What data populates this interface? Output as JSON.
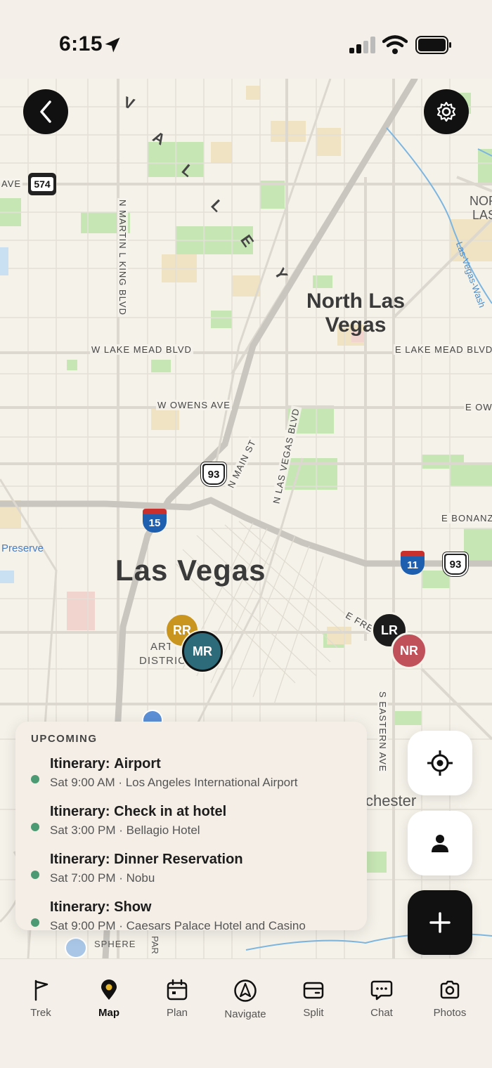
{
  "status_bar": {
    "time": "6:15"
  },
  "map": {
    "labels": {
      "city_main": "Las Vegas",
      "city_north_line1": "North Las",
      "city_north_line2": "Vegas",
      "valley": [
        "V",
        "A",
        "L",
        "L",
        "E",
        "Y"
      ],
      "streets": {
        "w_lake_mead": "W LAKE MEAD BLVD",
        "e_lake_mead": "E LAKE MEAD BLVD",
        "w_owens": "W OWENS AVE",
        "e_ow": "E OW",
        "n_martin": "N MARTIN L KING BLVD",
        "n_main": "N MAIN ST",
        "n_las_vegas_blvd": "N LAS VEGAS BLVD",
        "e_bonanza": "E BONANZ",
        "e_fremont": "E FRE",
        "s_eastern": "S EASTERN AVE",
        "ave_left": "AVE",
        "nor_las_1": "NOR",
        "nor_las_2": "LAS",
        "wash": "Las-Vegas-Wash",
        "preserve": "Preserve",
        "arts_1": "ART",
        "arts_2": "DISTRIC",
        "winchester": "chester",
        "sphere": "SPHERE",
        "par": "PAR"
      },
      "shields": {
        "us93_a": "93",
        "us93_b": "93",
        "i15": "15",
        "i11": "11",
        "state574": "574"
      }
    },
    "avatars": [
      {
        "initials": "RR",
        "color": "#c9951e"
      },
      {
        "initials": "MR",
        "color": "#2d6b7a"
      },
      {
        "initials": "LR",
        "color": "#1c1c1c"
      },
      {
        "initials": "NR",
        "color": "#c0505a"
      }
    ]
  },
  "upcoming": {
    "title": "UPCOMING",
    "items": [
      {
        "prefix": "Itinerary:",
        "name": "Airport",
        "detail": "Sat 9:00 AM · Los Angeles International Airport"
      },
      {
        "prefix": "Itinerary:",
        "name": "Check in at hotel",
        "detail": "Sat 3:00 PM · Bellagio Hotel"
      },
      {
        "prefix": "Itinerary:",
        "name": "Dinner Reservation",
        "detail": "Sat 7:00 PM · Nobu"
      },
      {
        "prefix": "Itinerary:",
        "name": "Show",
        "detail": "Sat 9:00 PM · Caesars Palace Hotel and Casino"
      }
    ]
  },
  "tabs": [
    {
      "label": "Trek",
      "icon": "flag-icon"
    },
    {
      "label": "Map",
      "icon": "map-pin-icon",
      "active": true
    },
    {
      "label": "Plan",
      "icon": "calendar-icon"
    },
    {
      "label": "Navigate",
      "icon": "navigate-icon"
    },
    {
      "label": "Split",
      "icon": "wallet-icon"
    },
    {
      "label": "Chat",
      "icon": "chat-icon"
    },
    {
      "label": "Photos",
      "icon": "camera-icon"
    }
  ],
  "colors": {
    "accent": "#111111",
    "dot": "#4c9a74",
    "pin_active": "#e5b52a"
  }
}
